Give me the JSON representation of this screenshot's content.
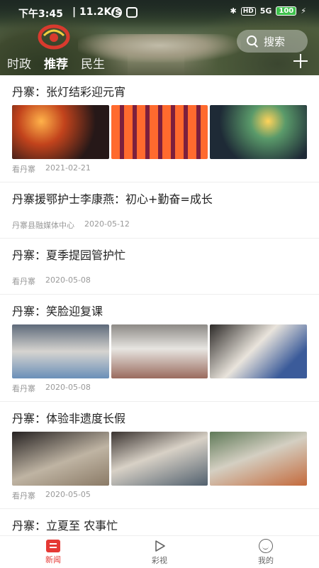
{
  "statusbar": {
    "time": "下午3:45",
    "network_speed": "| 11.2K/s",
    "signal": "5G",
    "battery": "100"
  },
  "header": {
    "search_label": "搜索",
    "tabs": [
      {
        "label": "时政",
        "active": false
      },
      {
        "label": "推荐",
        "active": true
      },
      {
        "label": "民生",
        "active": false
      }
    ]
  },
  "articles": [
    {
      "title": "丹寨：张灯结彩迎元宵",
      "source": "看丹寨",
      "date": "2021-02-21",
      "image_styles": [
        "ph-lantern1",
        "ph-lantern2",
        "ph-lantern3"
      ]
    },
    {
      "title": "丹寨援鄂护士李康燕：初心+勤奋=成长",
      "source": "丹寨县融媒体中心",
      "date": "2020-05-12",
      "image_styles": []
    },
    {
      "title": "丹寨：夏季提园管护忙",
      "source": "看丹寨",
      "date": "2020-05-08",
      "image_styles": []
    },
    {
      "title": "丹寨：笑脸迎复课",
      "source": "看丹寨",
      "date": "2020-05-08",
      "image_styles": [
        "ph-class1",
        "ph-class2",
        "ph-class3"
      ]
    },
    {
      "title": "丹寨：体验非遗度长假",
      "source": "看丹寨",
      "date": "2020-05-05",
      "image_styles": [
        "ph-craft1",
        "ph-craft2",
        "ph-craft3"
      ]
    },
    {
      "title": "丹寨：立夏至 农事忙",
      "source": "",
      "date": "",
      "image_styles": [
        "ph-farm1",
        "ph-farm2",
        "ph-farm3"
      ]
    }
  ],
  "bottom_nav": [
    {
      "label": "新闻",
      "icon": "news-icon",
      "active": true
    },
    {
      "label": "彩视",
      "icon": "play-icon",
      "active": false
    },
    {
      "label": "我的",
      "icon": "user-icon",
      "active": false
    }
  ],
  "colors": {
    "accent": "#e53935",
    "inactive": "#666666",
    "meta": "#999999"
  }
}
